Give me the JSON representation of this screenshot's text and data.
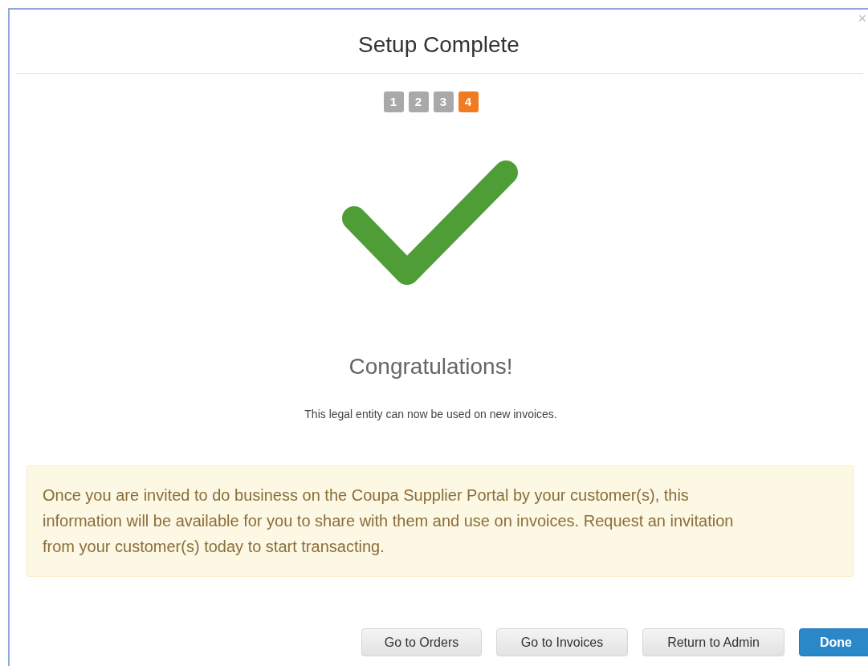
{
  "dialog": {
    "title": "Setup Complete",
    "close": "×"
  },
  "steps": [
    {
      "label": "1",
      "selected": false
    },
    {
      "label": "2",
      "selected": false
    },
    {
      "label": "3",
      "selected": false
    },
    {
      "label": "4",
      "selected": true
    }
  ],
  "heading": "Congratulations!",
  "message": "This legal entity can now be used on new invoices.",
  "alert": "Once you are invited to do business on the Coupa Supplier Portal by your customer(s), this information will be available for you to share with them and use on invoices. Request an invitation from your customer(s) today to start transacting.",
  "buttons": [
    {
      "label": "Go to Orders",
      "kind": "default"
    },
    {
      "label": "Go to Invoices",
      "kind": "default"
    },
    {
      "label": "Return to Admin",
      "kind": "default"
    },
    {
      "label": "Done",
      "kind": "primary"
    }
  ]
}
